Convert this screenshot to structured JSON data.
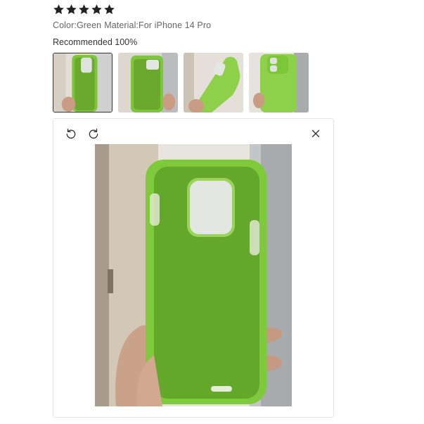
{
  "review": {
    "rating": 5,
    "rating_max": 5,
    "color_spec": "Color:Green",
    "material_spec": "Material:For iPhone 14 Pro",
    "recommended": "Recommended 100%"
  },
  "thumbnails": [
    {
      "label": "photo-1",
      "active": true
    },
    {
      "label": "photo-2",
      "active": false
    },
    {
      "label": "photo-3",
      "active": false
    },
    {
      "label": "photo-4",
      "active": false
    }
  ],
  "viewer": {
    "controls": [
      {
        "icon": "rotate-left-icon"
      },
      {
        "icon": "rotate-right-icon"
      },
      {
        "icon": "close-icon"
      }
    ]
  },
  "colors": {
    "case_green": "#7cc63a",
    "case_inner": "#6aa92e",
    "star": "#222222"
  }
}
